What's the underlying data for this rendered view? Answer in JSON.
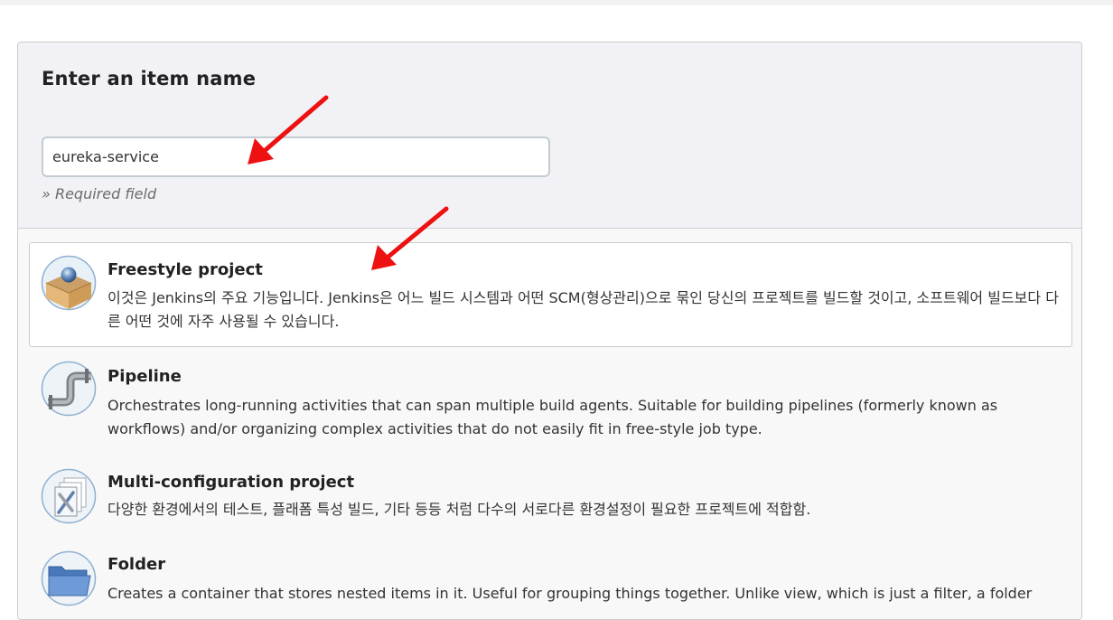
{
  "form": {
    "title": "Enter an item name",
    "item_name_value": "eureka-service",
    "required_hint": "» Required field"
  },
  "item_types": [
    {
      "name": "Freestyle project",
      "description": "이것은 Jenkins의 주요 기능입니다. Jenkins은 어느 빌드 시스템과 어떤 SCM(형상관리)으로 묶인 당신의 프로젝트를 빌드할 것이고, 소프트웨어 빌드보다 다른 어떤 것에 자주 사용될 수 있습니다.",
      "icon": "freestyle-project-icon",
      "selected": true
    },
    {
      "name": "Pipeline",
      "description": "Orchestrates long-running activities that can span multiple build agents. Suitable for building pipelines (formerly known as workflows) and/or organizing complex activities that do not easily fit in free-style job type.",
      "icon": "pipeline-icon",
      "selected": false
    },
    {
      "name": "Multi-configuration project",
      "description": "다양한 환경에서의 테스트, 플래폼 특성 빌드, 기타 등등 처럼 다수의 서로다른 환경설정이 필요한 프로젝트에 적합함.",
      "icon": "multi-configuration-icon",
      "selected": false
    },
    {
      "name": "Folder",
      "description": "Creates a container that stores nested items in it. Useful for grouping things together. Unlike view, which is just a filter, a folder",
      "icon": "folder-icon",
      "selected": false
    }
  ],
  "annotations": {
    "arrow_color": "#ee1111"
  },
  "colors": {
    "panel_bg": "#f8f8f8",
    "header_bg": "#f2f2f6",
    "input_border": "#c3ccd3"
  }
}
